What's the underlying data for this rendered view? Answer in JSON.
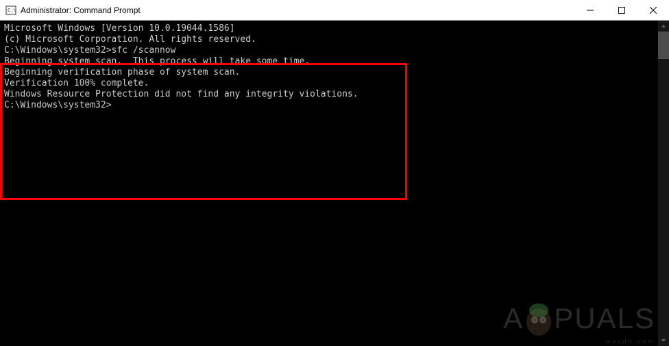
{
  "titlebar": {
    "title": "Administrator: Command Prompt"
  },
  "terminal": {
    "line1": "Microsoft Windows [Version 10.0.19044.1586]",
    "line2": "(c) Microsoft Corporation. All rights reserved.",
    "blank1": "",
    "prompt1": "C:\\Windows\\system32>sfc /scannow",
    "blank2": "",
    "line3": "Beginning system scan.  This process will take some time.",
    "blank3": "",
    "line4": "Beginning verification phase of system scan.",
    "line5": "Verification 100% complete.",
    "blank4": "",
    "line6": "Windows Resource Protection did not find any integrity violations.",
    "blank5": "",
    "prompt2": "C:\\Windows\\system32>"
  },
  "watermark": {
    "text_before": "A",
    "text_after": "PUALS",
    "subtext": "wssdn.com"
  }
}
